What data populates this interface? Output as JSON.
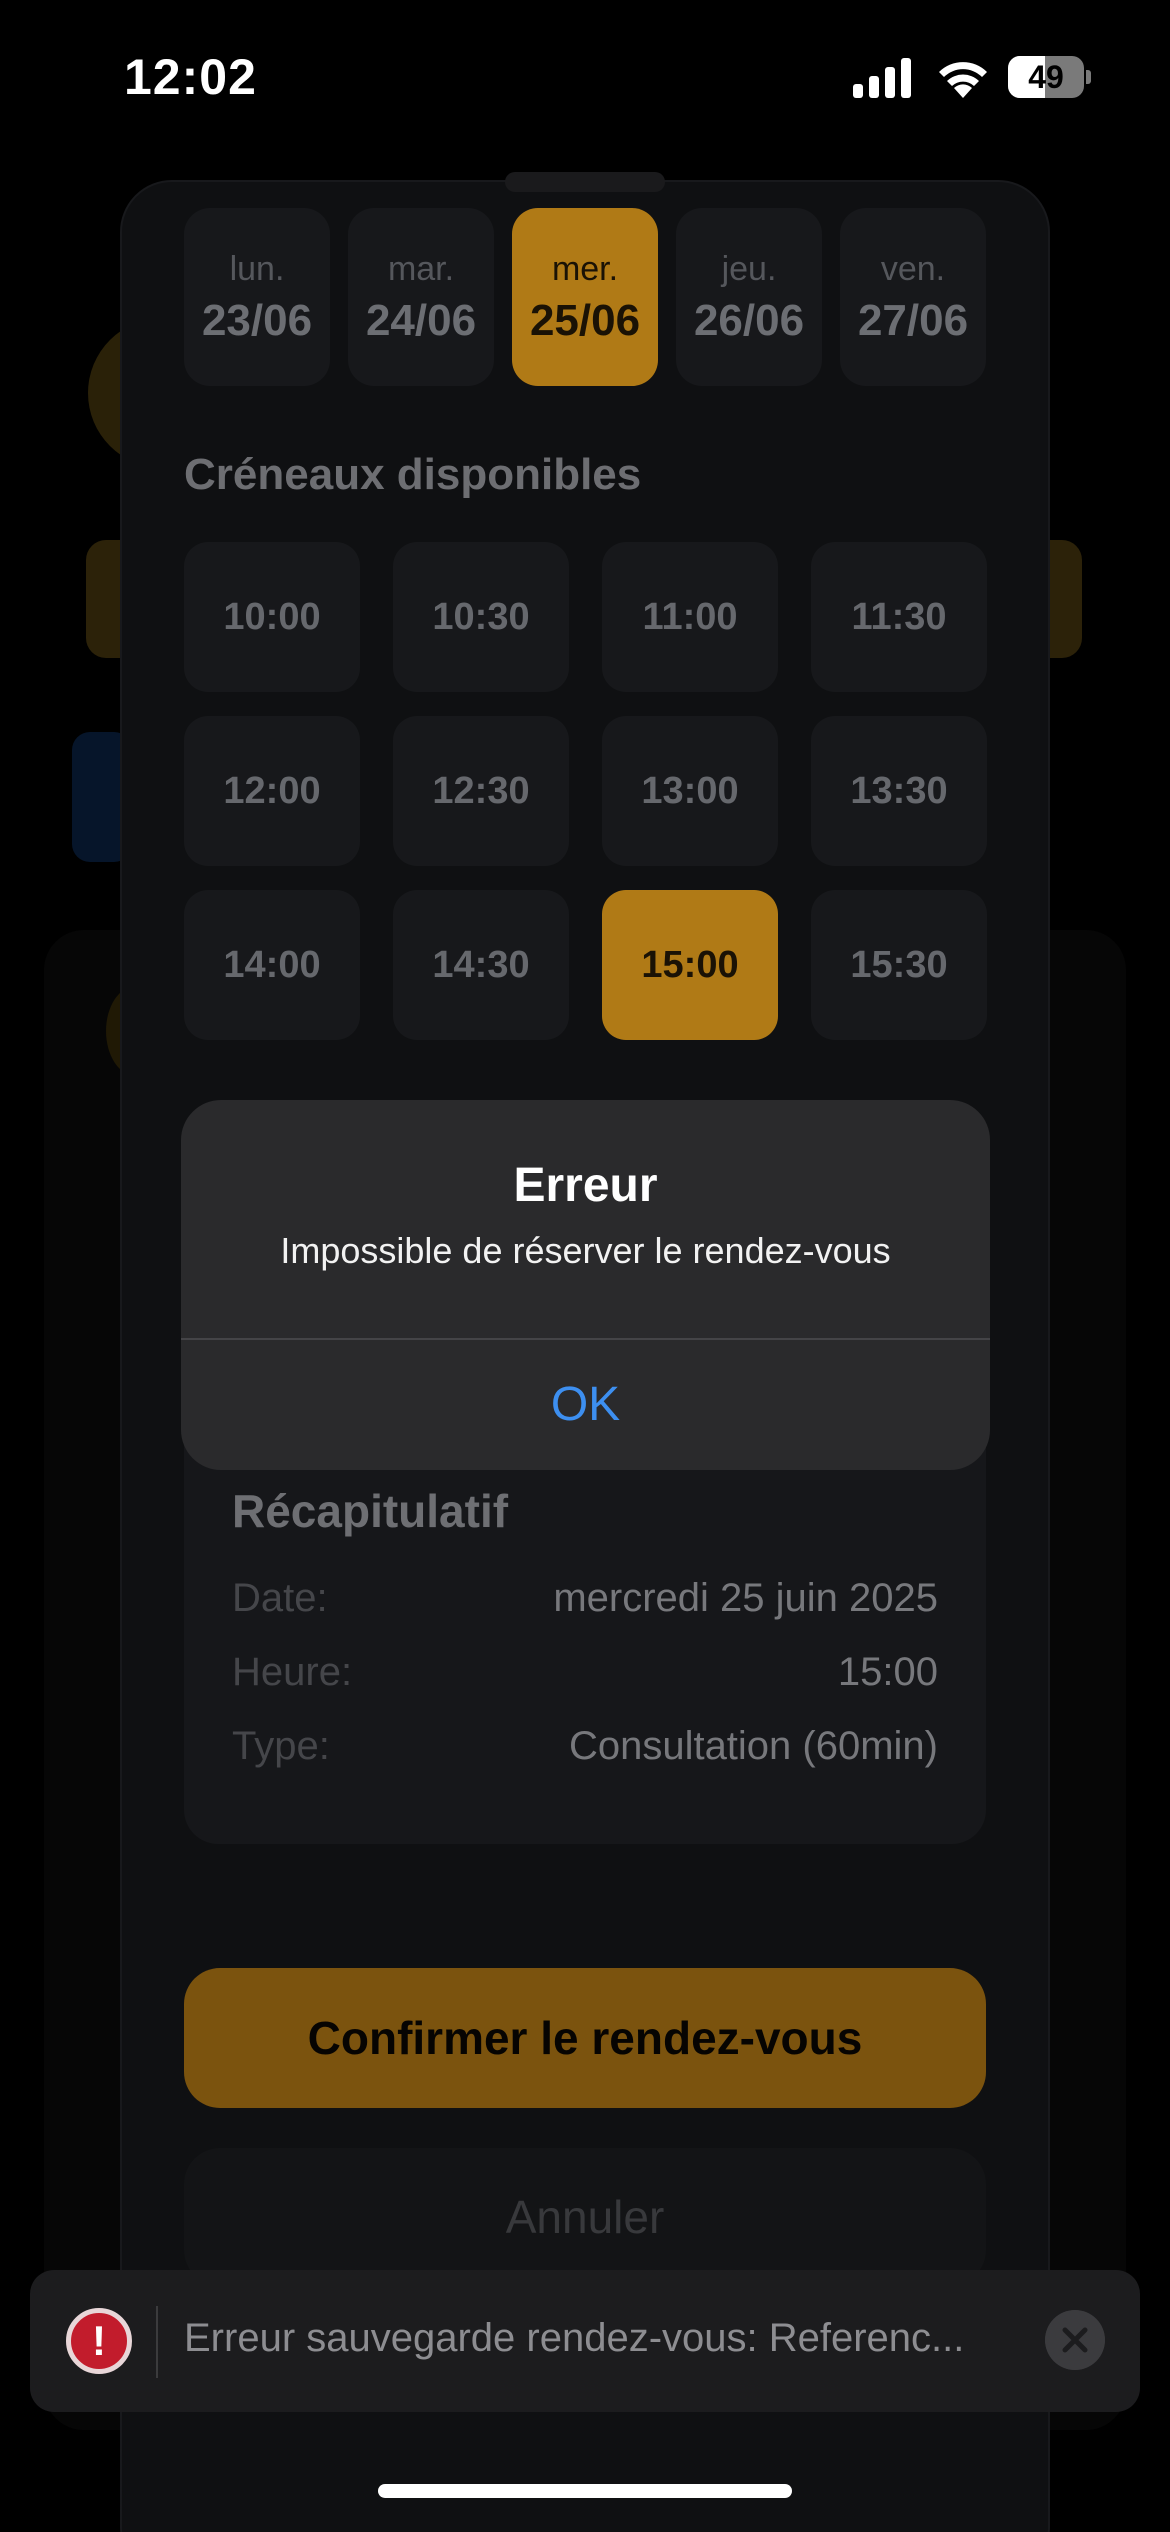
{
  "status_bar": {
    "time": "12:02",
    "battery_level": "49",
    "battery_fraction": 0.49,
    "icons": [
      "signal-icon",
      "wifi-icon",
      "battery-icon"
    ]
  },
  "days": [
    {
      "name": "lun.",
      "date": "23/06",
      "selected": false
    },
    {
      "name": "mar.",
      "date": "24/06",
      "selected": false
    },
    {
      "name": "mer.",
      "date": "25/06",
      "selected": true
    },
    {
      "name": "jeu.",
      "date": "26/06",
      "selected": false
    },
    {
      "name": "ven.",
      "date": "27/06",
      "selected": false
    }
  ],
  "slots_section": {
    "title": "Créneaux disponibles",
    "slots": [
      "10:00",
      "10:30",
      "11:00",
      "11:30",
      "12:00",
      "12:30",
      "13:00",
      "13:30",
      "14:00",
      "14:30",
      "15:00",
      "15:30"
    ],
    "selected": "15:00"
  },
  "summary": {
    "title": "Récapitulatif",
    "rows": [
      {
        "label": "Date:",
        "value": "mercredi 25 juin 2025"
      },
      {
        "label": "Heure:",
        "value": "15:00"
      },
      {
        "label": "Type:",
        "value": "Consultation (60min)"
      }
    ]
  },
  "buttons": {
    "confirm": "Confirmer le rendez-vous",
    "cancel": "Annuler"
  },
  "alert": {
    "title": "Erreur",
    "message": "Impossible de réserver le rendez-vous",
    "ok": "OK"
  },
  "toast": {
    "icon_glyph": "!",
    "message": "Erreur sauvegarde rendez-vous: Referenc..."
  },
  "colors": {
    "accent": "#b07a16",
    "alert_link": "#3d8ff0",
    "error": "#c21c2c"
  }
}
